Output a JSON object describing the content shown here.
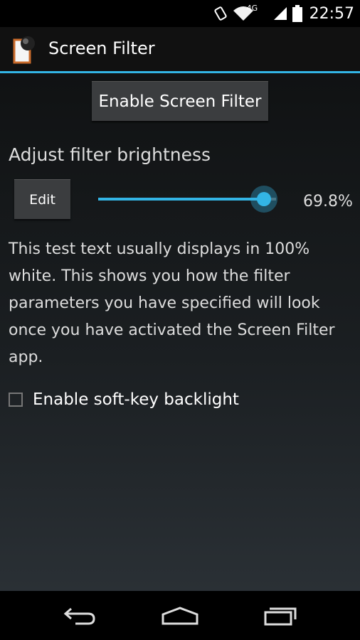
{
  "status_bar": {
    "network": "4G",
    "time": "22:57",
    "icons": [
      "screen-rotation-icon",
      "wifi-icon",
      "signal-icon",
      "battery-icon"
    ]
  },
  "action_bar": {
    "title": "Screen Filter",
    "icon": "app-icon"
  },
  "main": {
    "enable_button_label": "Enable Screen Filter",
    "brightness_heading": "Adjust filter brightness",
    "edit_button_label": "Edit",
    "brightness_value_text": "69.8%",
    "brightness_level": 0.93,
    "test_text": "This test text usually displays in 100% white. This shows you how the filter parameters you have specified will look once you have activated the Screen Filter app.",
    "soft_key_checkbox_label": "Enable soft-key backlight",
    "soft_key_checked": false
  },
  "nav_bar": {
    "buttons": [
      "back-icon",
      "home-icon",
      "recents-icon"
    ]
  },
  "colors": {
    "accent": "#33b5e5",
    "button": "#3b3d3f"
  }
}
